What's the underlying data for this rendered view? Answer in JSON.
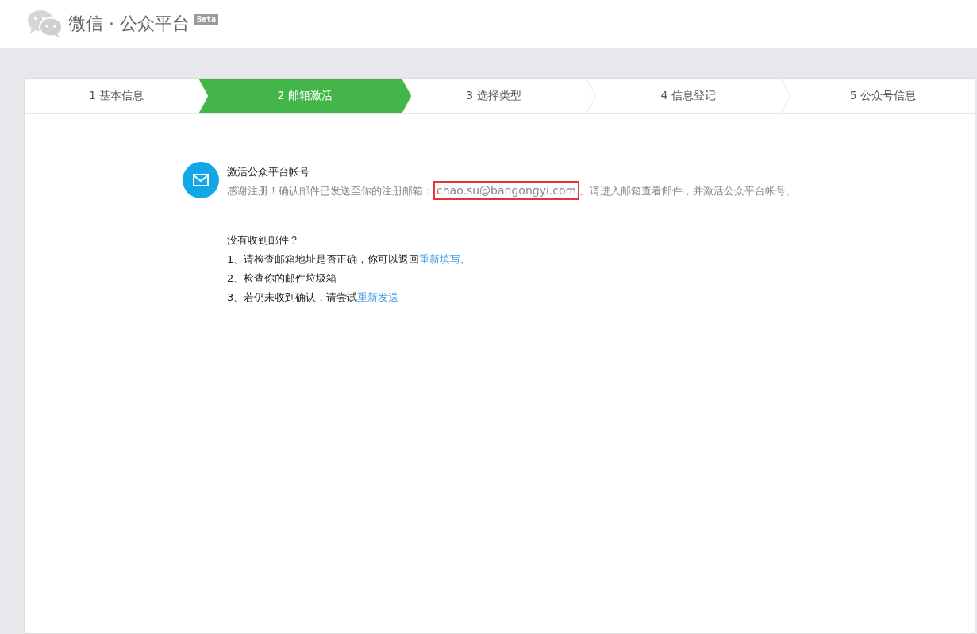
{
  "header": {
    "title": "微信 · 公众平台",
    "badge": "Beta"
  },
  "steps": [
    {
      "label": "1 基本信息",
      "selected": false
    },
    {
      "label": "2 邮箱激活",
      "selected": true
    },
    {
      "label": "3 选择类型",
      "selected": false
    },
    {
      "label": "4 信息登记",
      "selected": false
    },
    {
      "label": "5 公众号信息",
      "selected": false
    }
  ],
  "notice": {
    "title": "激活公众平台帐号",
    "text_before": "感谢注册！确认邮件已发送至你的注册邮箱：",
    "email": "chao.su@bangongyi.com",
    "email_highlighted": true,
    "text_after": "。请进入邮箱查看邮件，并激活公众平台帐号。"
  },
  "help": {
    "title": "没有收到邮件？",
    "items": [
      {
        "text": "1、请检查邮箱地址是否正确，你可以返回",
        "link": "重新填写",
        "after": "。"
      },
      {
        "text": "2、检查你的邮件垃圾箱"
      },
      {
        "text": "3、若仍未收到确认，请尝试",
        "link": "重新发送"
      }
    ]
  }
}
